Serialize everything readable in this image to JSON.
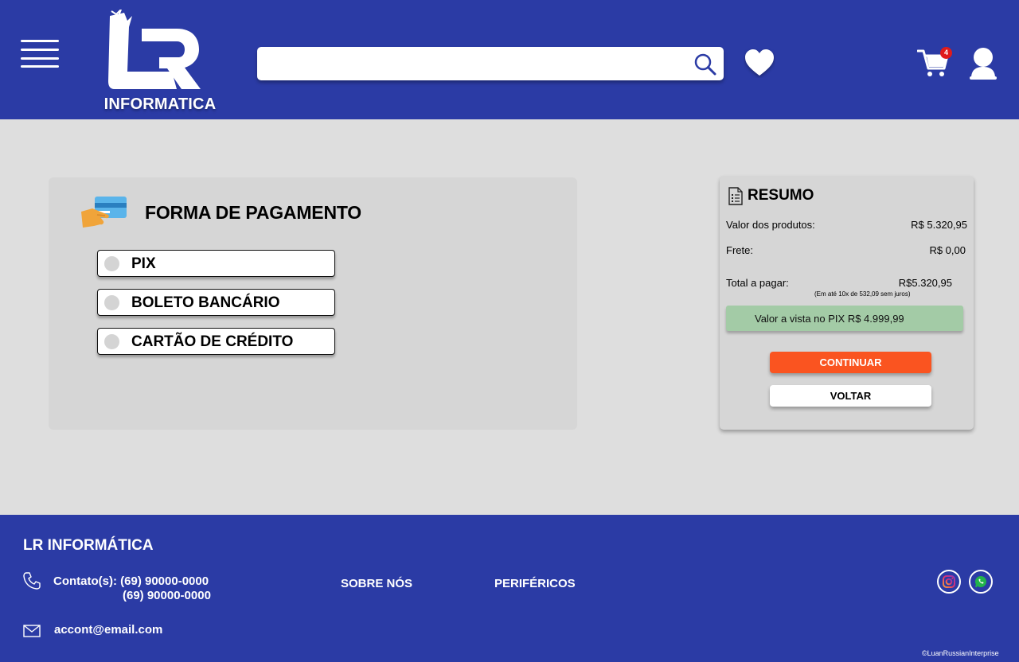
{
  "header": {
    "logo_word": "INFORMATICA",
    "logo_letters": "LR",
    "search": {
      "value": "",
      "placeholder": ""
    },
    "cart_count": "4"
  },
  "payment": {
    "title": "FORMA DE PAGAMENTO",
    "options": [
      {
        "label": "PIX",
        "selected": false
      },
      {
        "label": "BOLETO BANCÁRIO",
        "selected": false
      },
      {
        "label": "CARTÃO DE CRÉDITO",
        "selected": false
      }
    ]
  },
  "summary": {
    "title": "RESUMO",
    "products_label": "Valor dos produtos:",
    "products_value": "R$ 5.320,95",
    "shipping_label": "Frete:",
    "shipping_value": "R$ 0,00",
    "total_label": "Total a pagar:",
    "total_value": "R$5.320,95",
    "installments": "(Em até 10x de 532,09 sem juros)",
    "pix_offer": "Valor a vista no PIX R$ 4.999,99",
    "continue_label": "CONTINUAR",
    "back_label": "VOLTAR"
  },
  "footer": {
    "brand": "LR INFORMÁTICA",
    "contact_label": "Contato(s): (69) 90000-0000",
    "contact_2": "(69) 90000-0000",
    "email": "accont@email.com",
    "link_about": "SOBRE NÓS",
    "link_peripherals": "PERIFÉRICOS",
    "copyright": "©LuanRussianInterprise"
  },
  "colors": {
    "brand_blue": "#2b3ba5",
    "continue_orange": "#fa5420",
    "pix_green": "#a3cba6",
    "background": "#dedede",
    "panel": "#d6d6d6",
    "badge_red": "#e01b1b"
  },
  "icons": [
    "hamburger-menu-icon",
    "search-icon",
    "heart-icon",
    "cart-icon",
    "user-icon",
    "credit-card-icon",
    "document-icon",
    "phone-icon",
    "mail-icon",
    "instagram-icon",
    "whatsapp-icon"
  ]
}
